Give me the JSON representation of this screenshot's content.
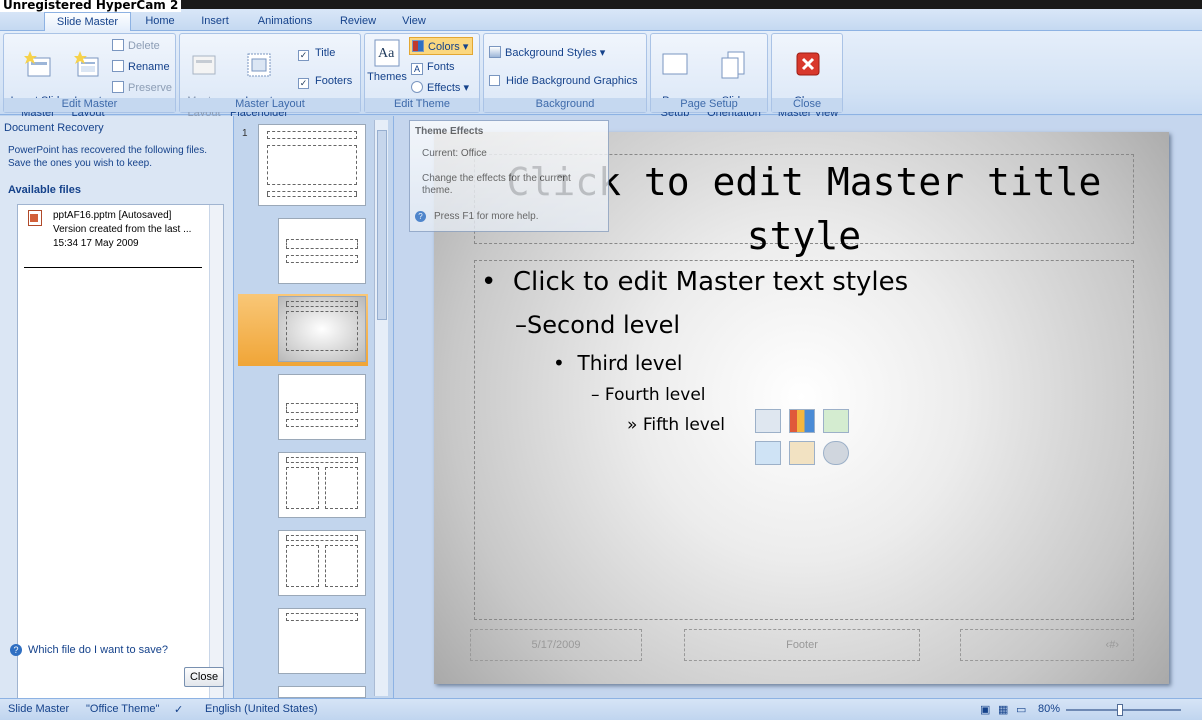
{
  "watermark": "Unregistered HyperCam 2",
  "tabs": [
    {
      "label": "Slide Master"
    },
    {
      "label": "Home"
    },
    {
      "label": "Insert"
    },
    {
      "label": "Animations"
    },
    {
      "label": "Review"
    },
    {
      "label": "View"
    }
  ],
  "ribbon": {
    "edit_master": {
      "label": "Edit Master",
      "insert_slide_master": "Insert Slide\nMaster",
      "insert_layout": "Insert\nLayout",
      "delete": "Delete",
      "rename": "Rename",
      "preserve": "Preserve"
    },
    "master_layout": {
      "label": "Master Layout",
      "master_layout_btn": "Master\nLayout",
      "insert_placeholder": "Insert\nPlaceholder",
      "title_cb": "Title",
      "footers_cb": "Footers"
    },
    "edit_theme": {
      "label": "Edit Theme",
      "themes": "Themes",
      "colors": "Colors",
      "fonts": "Fonts",
      "effects": "Effects"
    },
    "background": {
      "label": "Background",
      "background_styles": "Background Styles",
      "hide_background_graphics": "Hide Background Graphics"
    },
    "page_setup": {
      "label": "Page Setup",
      "page_setup_btn": "Page\nSetup",
      "slide_orientation": "Slide\nOrientation"
    },
    "close": {
      "label": "Close",
      "close_master_view": "Close\nMaster View"
    }
  },
  "recovery": {
    "title": "Document Recovery",
    "message": "PowerPoint has recovered the following files. Save the ones you wish to keep.",
    "available": "Available files",
    "file_name": "pptAF16.pptm  [Autosaved]",
    "file_desc": "Version created from the last ...",
    "file_time": "15:34 17 May 2009",
    "help_link": "Which file do I want to save?",
    "close": "Close"
  },
  "thumbnails": {
    "first_number": "1"
  },
  "slide": {
    "title": "Click to edit Master title style",
    "levels": [
      {
        "bullet": "•",
        "text": "Click to edit Master text styles"
      },
      {
        "bullet": "–",
        "text": "Second level"
      },
      {
        "bullet": "•",
        "text": "Third level"
      },
      {
        "bullet": "–",
        "text": "Fourth level"
      },
      {
        "bullet": "»",
        "text": "Fifth level"
      }
    ],
    "date_placeholder": "5/17/2009",
    "footer_placeholder": "Footer",
    "number_placeholder": "‹#›"
  },
  "tooltip": {
    "title": "Theme Effects",
    "current": "Current: Office",
    "description": "Change the effects for the current theme.",
    "help": "Press F1 for more help."
  },
  "status": {
    "view": "Slide Master",
    "theme": "\"Office Theme\"",
    "language": "English (United States)",
    "zoom": "80%"
  }
}
